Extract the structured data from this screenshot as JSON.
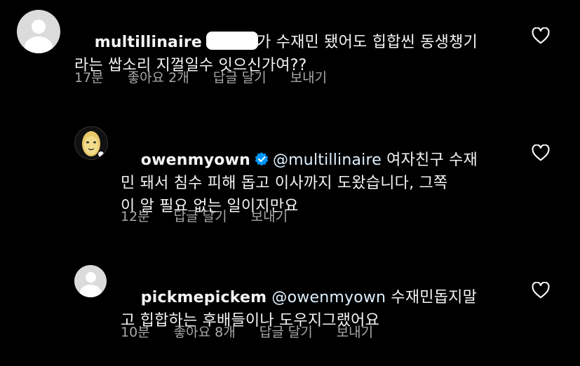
{
  "comments": [
    {
      "username": "multillinaire",
      "text_line1": "가 수재민 됐어도 힙합씬 동생챙기",
      "text_line2": "라는 쌉소리 지껄일수 잇으신가여??",
      "time": "17분",
      "likes": "좋아요 2개",
      "reply": "답글 달기",
      "send": "보내기"
    },
    {
      "username": "owenmyown",
      "mention": "@multillinaire",
      "text_line1": " 여자친구 수재",
      "text_line2": "민 돼서 침수 피해 돕고 이사까지 도왔습니다, 그쪽",
      "text_line3": "이 알 필요 없는 일이지만요",
      "time": "12분",
      "reply": "답글 달기",
      "send": "보내기"
    },
    {
      "username": "pickmepickem",
      "mention": "@owenmyown",
      "text_line1": " 수재민돕지말",
      "text_line2": "고 힙합하는 후배들이나 도우지그랬어요",
      "time": "10분",
      "likes": "좋아요 8개",
      "reply": "답글 달기",
      "send": "보내기"
    }
  ],
  "colors": {
    "background": "#000000",
    "text": "#f5f5f5",
    "meta": "#a8a8a8",
    "verified": "#0095f6"
  },
  "icons": {
    "like": "heart-outline-icon",
    "verified": "verified-badge-icon",
    "avatar_default": "default-avatar-icon"
  }
}
